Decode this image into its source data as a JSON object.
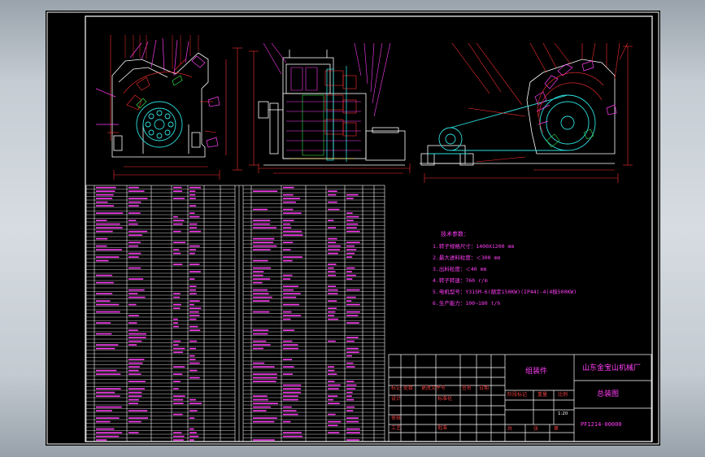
{
  "colors": {
    "frame": "#ffffff",
    "dimension": "#ff2f2f",
    "outline": "#ffffff",
    "pulley": "#2ee0e0",
    "detail": "#ff3df5",
    "table_lines": "#ffffff",
    "table_text": "#ff3df5",
    "title_text": "#e64040",
    "green": "#36e04a",
    "yellow": "#ffe23a"
  },
  "technical_specs": {
    "heading": "技术参数：",
    "lines": [
      "1.转子规格尺寸：1400X1200  mm",
      "2.最大进料粒度：＜300  mm",
      "3.出料粒度：＜40  mm",
      "4.转子转速：760  r/m",
      "5.电机型号：Y315M-6(额定150KW)(IP44)-4(4极500KW)",
      "6.生产能力：100~180 t/h"
    ]
  },
  "title_block": {
    "header_labels": [
      "标记",
      "处数",
      "更改文件号",
      "签名",
      "日期"
    ],
    "design_label": "设计",
    "standard_label": "标准化",
    "stage_mark_label": "阶段标记",
    "weight_label": "重量",
    "scale_label": "比例",
    "scale_value": "1:20",
    "review_label": "审核",
    "process_label": "工艺",
    "approve_label": "批准",
    "sheet_total_label": "共",
    "sheet_label": "张",
    "page_label": "第",
    "assembly_label": "组装件",
    "company": "山东金宝山机械厂",
    "drawing_name": "总装图",
    "drawing_number": "PF1214-00000"
  }
}
